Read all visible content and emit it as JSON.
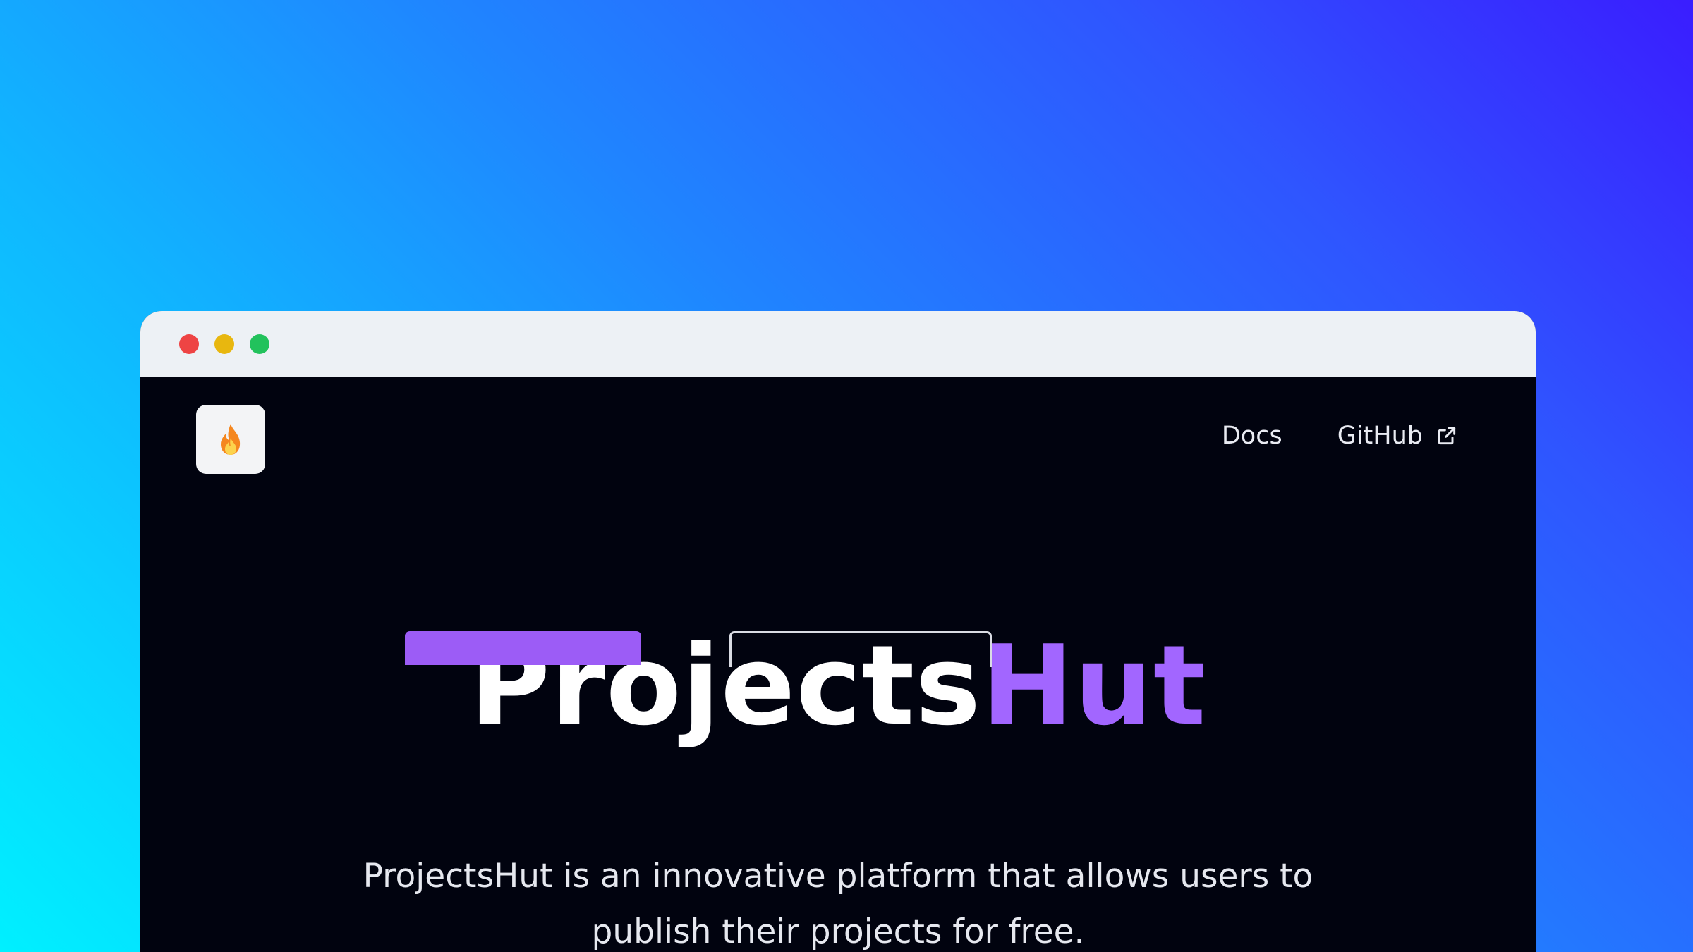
{
  "colors": {
    "background_gradient": [
      "#00f0ff",
      "#1f86ff",
      "#3a1dff"
    ],
    "titlebar": "#edf1f5",
    "traffic_red": "#ee4444",
    "traffic_yellow": "#e8b70f",
    "traffic_green": "#22c25c",
    "page_background": "#01030f",
    "accent": "#a266ff",
    "primary_button": "#9c5cf6"
  },
  "window": {
    "controls": [
      "close",
      "minimize",
      "maximize"
    ]
  },
  "header": {
    "logo_icon": "fire-icon",
    "nav": [
      {
        "label": "Docs"
      },
      {
        "label": "GitHub",
        "icon": "external-link-icon"
      }
    ]
  },
  "hero": {
    "title_main": "Projects",
    "title_accent": "Hut",
    "description": "ProjectsHut is an innovative platform that allows users to publish their projects for free."
  },
  "actions": {
    "primary_label": "",
    "secondary_label": ""
  }
}
